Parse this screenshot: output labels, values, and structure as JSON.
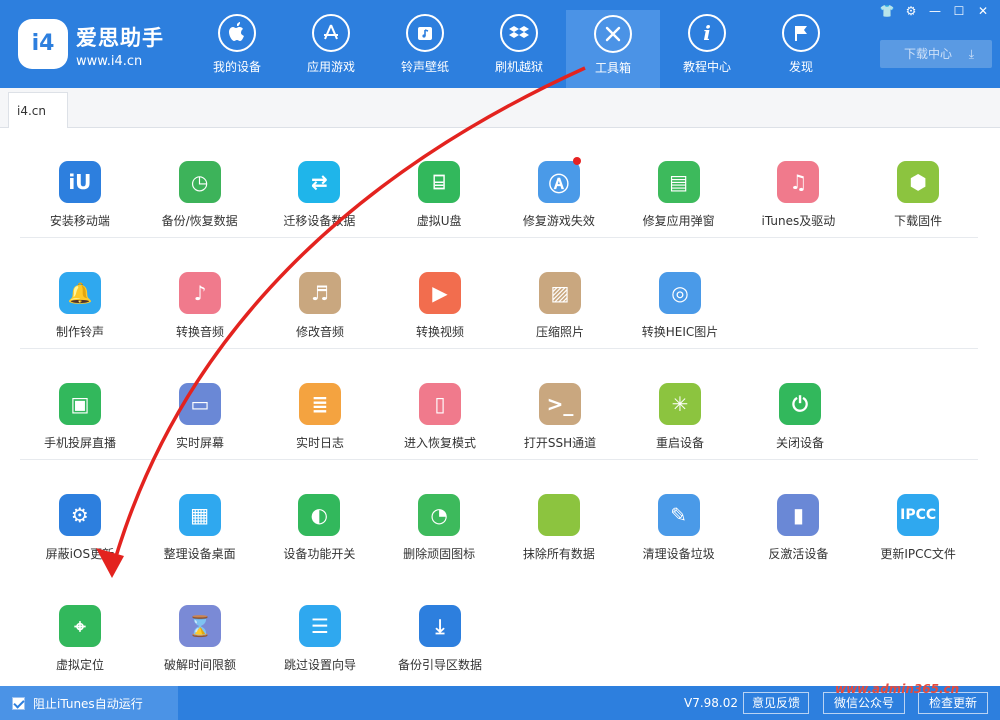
{
  "app": {
    "brand_name": "爱思助手",
    "brand_url": "www.i4.cn",
    "logo_text": "i4"
  },
  "nav": [
    {
      "label": "我的设备",
      "icon": "apple-icon"
    },
    {
      "label": "应用游戏",
      "icon": "app-store-icon"
    },
    {
      "label": "铃声壁纸",
      "icon": "music-icon"
    },
    {
      "label": "刷机越狱",
      "icon": "dropbox-icon"
    },
    {
      "label": "工具箱",
      "icon": "toolbox-icon",
      "active": true
    },
    {
      "label": "教程中心",
      "icon": "info-icon"
    },
    {
      "label": "发现",
      "icon": "flag-icon"
    }
  ],
  "window_controls": [
    "shirt-icon",
    "gear-icon",
    "minimize-icon",
    "maximize-icon",
    "close-icon"
  ],
  "download": {
    "label": "下载中心"
  },
  "tab": {
    "label": "i4.cn"
  },
  "tools": [
    [
      {
        "label": "安装移动端",
        "icon": "i4-app-icon",
        "color": "#2d7fde"
      },
      {
        "label": "备份/恢复数据",
        "icon": "backup-clock-icon",
        "color": "#3db35a"
      },
      {
        "label": "迁移设备数据",
        "icon": "transfer-devices-icon",
        "color": "#1fb5ea"
      },
      {
        "label": "虚拟U盘",
        "icon": "usb-drive-icon",
        "color": "#32b85c"
      },
      {
        "label": "修复游戏失效",
        "icon": "app-store-repair-icon",
        "color": "#4a9ae8",
        "badge": true
      },
      {
        "label": "修复应用弹窗",
        "icon": "apple-id-icon",
        "color": "#3dba5c"
      },
      {
        "label": "iTunes及驱动",
        "icon": "itunes-icon",
        "color": "#f07a8c"
      },
      {
        "label": "下载固件",
        "icon": "cube-icon",
        "color": "#8cc43f"
      }
    ],
    [
      {
        "label": "制作铃声",
        "icon": "bell-icon",
        "color": "#2fa8ef"
      },
      {
        "label": "转换音频",
        "icon": "music-note-icon",
        "color": "#f07a8c"
      },
      {
        "label": "修改音频",
        "icon": "audio-edit-icon",
        "color": "#c9a77f"
      },
      {
        "label": "转换视频",
        "icon": "play-icon",
        "color": "#f26d4e"
      },
      {
        "label": "压缩照片",
        "icon": "photo-icon",
        "color": "#c9a77f"
      },
      {
        "label": "转换HEIC图片",
        "icon": "heic-icon",
        "color": "#4a9ae8"
      }
    ],
    [
      {
        "label": "手机投屏直播",
        "icon": "screen-cast-icon",
        "color": "#32b85c"
      },
      {
        "label": "实时屏幕",
        "icon": "monitor-icon",
        "color": "#6a88d6"
      },
      {
        "label": "实时日志",
        "icon": "document-icon",
        "color": "#f4a340"
      },
      {
        "label": "进入恢复模式",
        "icon": "phone-cable-icon",
        "color": "#f07a8c"
      },
      {
        "label": "打开SSH通道",
        "icon": "terminal-icon",
        "color": "#c9a77f"
      },
      {
        "label": "重启设备",
        "icon": "restart-icon",
        "color": "#8cc43f"
      },
      {
        "label": "关闭设备",
        "icon": "power-icon",
        "color": "#32b85c"
      }
    ],
    [
      {
        "label": "屏蔽iOS更新",
        "icon": "block-update-gear-icon",
        "color": "#2d7fde"
      },
      {
        "label": "整理设备桌面",
        "icon": "grid-icon",
        "color": "#2fa8ef"
      },
      {
        "label": "设备功能开关",
        "icon": "toggle-icon",
        "color": "#32b85c"
      },
      {
        "label": "删除顽固图标",
        "icon": "pie-icon",
        "color": "#3dba5c"
      },
      {
        "label": "抹除所有数据",
        "icon": "apple-erase-icon",
        "color": "#8cc43f"
      },
      {
        "label": "清理设备垃圾",
        "icon": "broom-icon",
        "color": "#4a9ae8"
      },
      {
        "label": "反激活设备",
        "icon": "tablet-icon",
        "color": "#6a88d6"
      },
      {
        "label": "更新IPCC文件",
        "icon": "ipcc-icon",
        "color": "#2fa8ef",
        "text": "IPCC"
      }
    ],
    [
      {
        "label": "虚拟定位",
        "icon": "location-pin-icon",
        "color": "#32b85c"
      },
      {
        "label": "破解时间限额",
        "icon": "hourglass-icon",
        "color": "#7a8ad6"
      },
      {
        "label": "跳过设置向导",
        "icon": "skip-setup-icon",
        "color": "#2fa8ef"
      },
      {
        "label": "备份引导区数据",
        "icon": "boot-backup-icon",
        "color": "#2d7fde"
      }
    ]
  ],
  "footer": {
    "itunes_label": "阻止iTunes自动运行",
    "version": "V7.98.02",
    "feedback": "意见反馈",
    "wechat": "微信公众号",
    "update": "检查更新"
  },
  "watermark": "www.admin365.cn"
}
